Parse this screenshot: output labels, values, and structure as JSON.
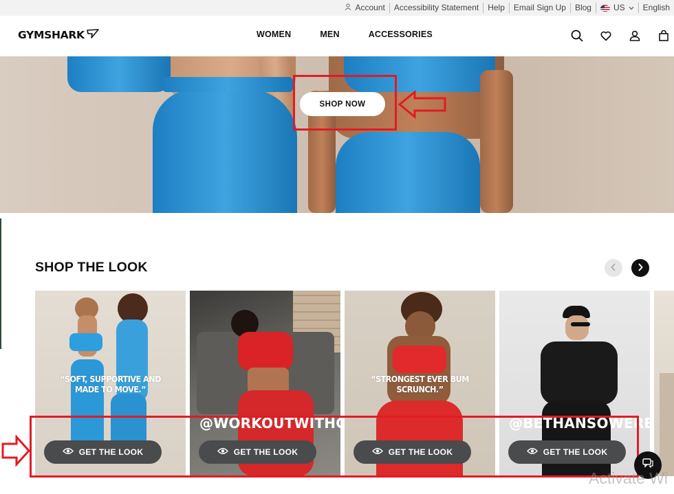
{
  "utility_bar": {
    "links": [
      {
        "key": "account",
        "label": "Account",
        "icon": "user-outline-icon"
      },
      {
        "key": "accessibility",
        "label": "Accessibility Statement"
      },
      {
        "key": "help",
        "label": "Help"
      },
      {
        "key": "email",
        "label": "Email Sign Up"
      },
      {
        "key": "blog",
        "label": "Blog"
      },
      {
        "key": "region",
        "label": "US",
        "icon": "us-flag-icon"
      },
      {
        "key": "language",
        "label": "English"
      }
    ]
  },
  "header": {
    "logo_text": "GYMSHARK",
    "nav": [
      "WOMEN",
      "MEN",
      "ACCESSORIES"
    ],
    "icons": [
      "search-icon",
      "wishlist-heart-icon",
      "account-icon",
      "bag-icon"
    ]
  },
  "hero": {
    "cta_label": "SHOP NOW",
    "colors": {
      "leggings_blue": "#2a92d4",
      "background": "#d3c5b8"
    }
  },
  "shop_the_look": {
    "title": "SHOP THE LOOK",
    "cards": [
      {
        "quote": "“SOFT, SUPPORTIVE AND MADE TO MOVE.”",
        "handle": "",
        "button": "GET THE LOOK"
      },
      {
        "quote": "",
        "handle": "@WORKOUTWITHG",
        "button": "GET THE LOOK"
      },
      {
        "quote": "“STRONGEST EVER BUM SCRUNCH.”",
        "handle": "",
        "button": "GET THE LOOK"
      },
      {
        "quote": "",
        "handle": "@BETHANSOWERB",
        "button": "GET THE LOOK"
      }
    ]
  },
  "watermark_text": "Activate Wi",
  "annotation_color": "#e01b24"
}
